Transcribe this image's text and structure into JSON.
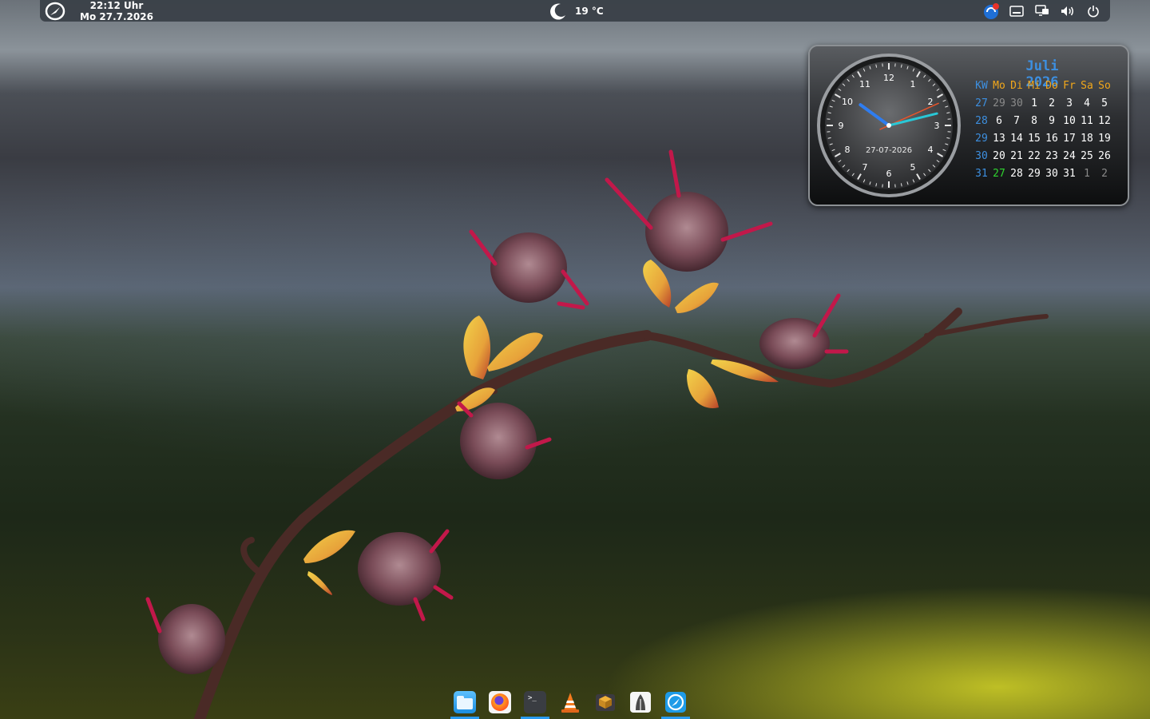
{
  "top_panel": {
    "time": "22:12 Uhr",
    "date": "Mo 27.7.2026",
    "weather": {
      "icon": "moon-icon",
      "temperature": "19 °C"
    },
    "tray_icons": [
      "update-notifier-icon",
      "keyboard-icon",
      "network-icon",
      "volume-icon",
      "power-icon"
    ]
  },
  "widget": {
    "analog_clock": {
      "date_label": "27-07-2026",
      "numerals": [
        "12",
        "1",
        "2",
        "3",
        "4",
        "5",
        "6",
        "7",
        "8",
        "9",
        "10",
        "11"
      ],
      "hour": 22,
      "minute": 12,
      "second": 41
    },
    "calendar": {
      "title": "Juli 2026",
      "headers": [
        "KW",
        "Mo",
        "Di",
        "Mi",
        "Do",
        "Fr",
        "Sa",
        "So"
      ],
      "weeks": [
        {
          "kw": "27",
          "days": [
            "29",
            "30",
            "1",
            "2",
            "3",
            "4",
            "5"
          ],
          "other": [
            0,
            1
          ]
        },
        {
          "kw": "28",
          "days": [
            "6",
            "7",
            "8",
            "9",
            "10",
            "11",
            "12"
          ],
          "other": []
        },
        {
          "kw": "29",
          "days": [
            "13",
            "14",
            "15",
            "16",
            "17",
            "18",
            "19"
          ],
          "other": []
        },
        {
          "kw": "30",
          "days": [
            "20",
            "21",
            "22",
            "23",
            "24",
            "25",
            "26"
          ],
          "other": []
        },
        {
          "kw": "31",
          "days": [
            "27",
            "28",
            "29",
            "30",
            "31",
            "1",
            "2"
          ],
          "other": [
            5,
            6
          ]
        }
      ],
      "today": "27"
    }
  },
  "dock": {
    "items": [
      {
        "name": "files",
        "icon": "folder-icon",
        "active": true
      },
      {
        "name": "firefox",
        "icon": "firefox-icon",
        "active": false
      },
      {
        "name": "terminal",
        "icon": "terminal-icon",
        "active": true
      },
      {
        "name": "vlc",
        "icon": "vlc-cone-icon",
        "active": false
      },
      {
        "name": "archive",
        "icon": "archive-box-icon",
        "active": false
      },
      {
        "name": "inkscape",
        "icon": "pen-nib-icon",
        "active": false
      },
      {
        "name": "system",
        "icon": "distro-logo-icon",
        "active": true
      }
    ]
  },
  "colors": {
    "accent": "#2a9bf0",
    "calendar_weekday": "#f2a71b",
    "calendar_kw": "#3d8fe0",
    "calendar_today": "#2fd42f",
    "clock_minute_hand": "#29c7d6",
    "clock_hour_hand": "#2f7df0",
    "clock_second_hand": "#e8542a"
  }
}
